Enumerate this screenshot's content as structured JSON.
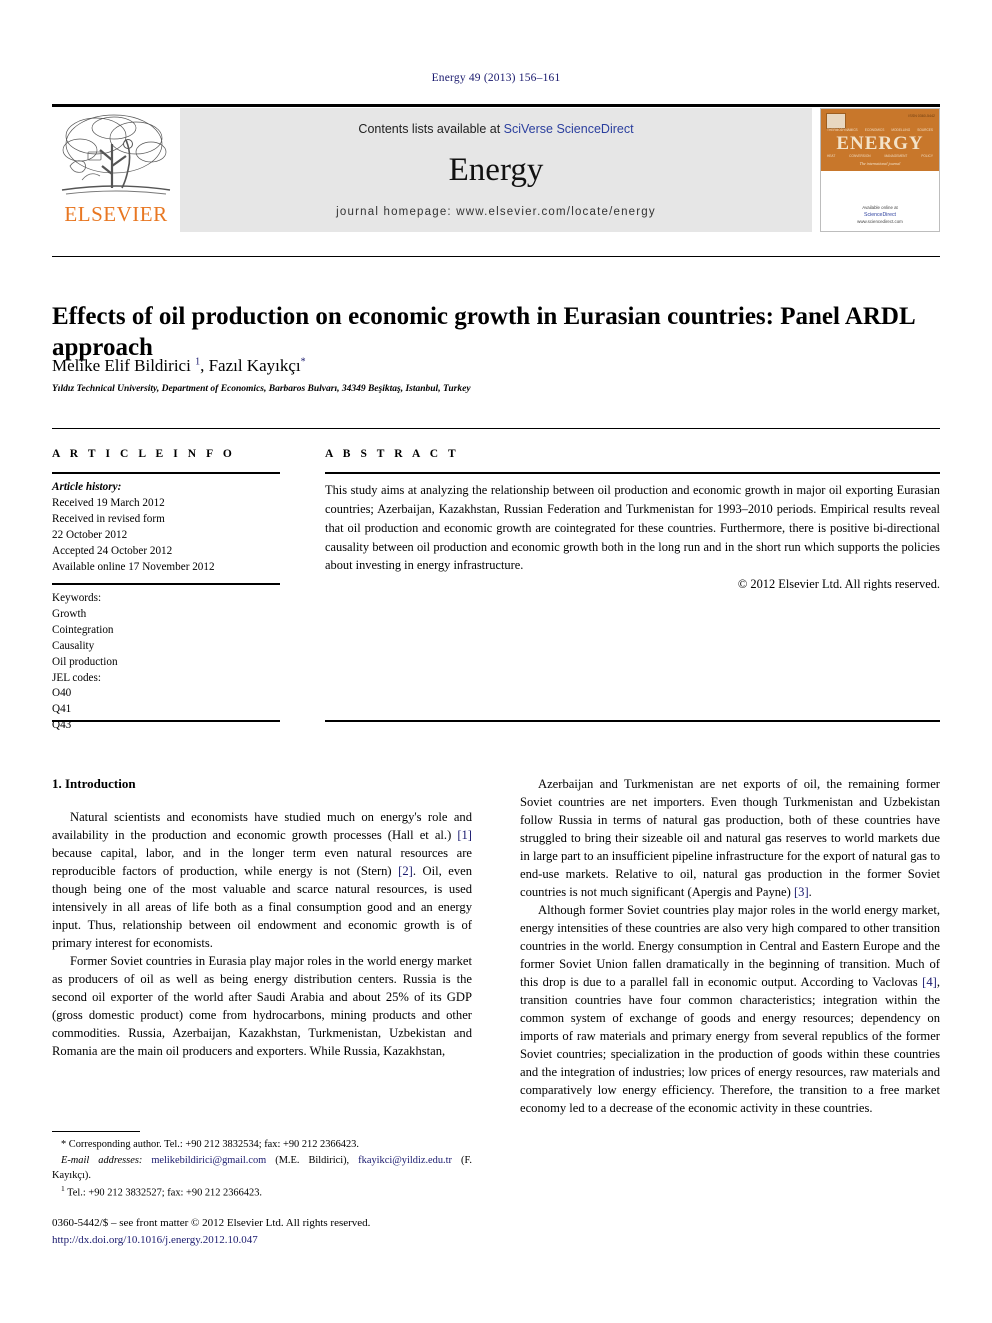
{
  "running_head": "Energy 49 (2013) 156–161",
  "masthead": {
    "contents_prefix": "Contents lists available at ",
    "sciencedirect": "SciVerse ScienceDirect",
    "journal_name": "Energy",
    "homepage": "journal homepage: www.elsevier.com/locate/energy",
    "publisher_wordmark": "ELSEVIER",
    "cover": {
      "title": "ENERGY",
      "subtitle": "The international journal",
      "code": "ISSN 0360-5442",
      "tags_top": [
        "THERMODYNAMICS",
        "ECONOMICS",
        "MODELLING",
        "SOURCES"
      ],
      "tags_bottom": [
        "HEAT",
        "CONVERSION",
        "MANAGEMENT",
        "POLICY"
      ],
      "available_at": "Available online at",
      "brand": "ScienceDirect",
      "site": "www.sciencedirect.com"
    }
  },
  "article": {
    "title": "Effects of oil production on economic growth in Eurasian countries: Panel ARDL approach",
    "authors_html": "Melike Elif Bildirici <sup>1</sup>, Fazıl Kayıkçı<sup>*</sup>",
    "affiliation": "Yıldız Technical University, Department of Economics, Barbaros Bulvarı, 34349 Beşiktaş, Istanbul, Turkey"
  },
  "info": {
    "heading": "A R T I C L E   I N F O",
    "history_label": "Article history:",
    "history": [
      "Received 19 March 2012",
      "Received in revised form",
      "22 October 2012",
      "Accepted 24 October 2012",
      "Available online 17 November 2012"
    ],
    "keywords_label": "Keywords:",
    "keywords": [
      "Growth",
      "Cointegration",
      "Causality",
      "Oil production"
    ],
    "jel_label": "JEL codes:",
    "jel_codes": [
      "O40",
      "Q41",
      "Q43"
    ]
  },
  "abstract": {
    "heading": "A B S T R A C T",
    "text": "This study aims at analyzing the relationship between oil production and economic growth in major oil exporting Eurasian countries; Azerbaijan, Kazakhstan, Russian Federation and Turkmenistan for 1993–2010 periods. Empirical results reveal that oil production and economic growth are cointegrated for these countries. Furthermore, there is positive bi-directional causality between oil production and economic growth both in the long run and in the short run which supports the policies about investing in energy infrastructure.",
    "copyright": "© 2012 Elsevier Ltd. All rights reserved."
  },
  "body": {
    "section_heading": "1. Introduction",
    "left_paragraphs": [
      {
        "pre": "Natural scientists and economists have studied much on energy's role and availability in the production and economic growth processes (Hall et al.) ",
        "ref1": "[1]",
        "mid": " because capital, labor, and in the longer term even natural resources are reproducible factors of production, while energy is not (Stern) ",
        "ref2": "[2]",
        "post": ". Oil, even though being one of the most valuable and scarce natural resources, is used intensively in all areas of life both as a final consumption good and an energy input. Thus, relationship between oil endowment and economic growth is of primary interest for economists."
      },
      {
        "text": "Former Soviet countries in Eurasia play major roles in the world energy market as producers of oil as well as being energy distribution centers. Russia is the second oil exporter of the world after Saudi Arabia and about 25% of its GDP (gross domestic product) come from hydrocarbons, mining products and other commodities. Russia, Azerbaijan, Kazakhstan, Turkmenistan, Uzbekistan and Romania are the main oil producers and exporters. While Russia, Kazakhstan,"
      }
    ],
    "right_paragraphs": [
      {
        "pre": "Azerbaijan and Turkmenistan are net exports of oil, the remaining former Soviet countries are net importers. Even though Turkmenistan and Uzbekistan follow Russia in terms of natural gas production, both of these countries have struggled to bring their sizeable oil and natural gas reserves to world markets due in large part to an insufficient pipeline infrastructure for the export of natural gas to end-use markets. Relative to oil, natural gas production in the former Soviet countries is not much significant (Apergis and Payne) ",
        "ref1": "[3]",
        "post": "."
      },
      {
        "pre": "Although former Soviet countries play major roles in the world energy market, energy intensities of these countries are also very high compared to other transition countries in the world. Energy consumption in Central and Eastern Europe and the former Soviet Union fallen dramatically in the beginning of transition. Much of this drop is due to a parallel fall in economic output. According to Vaclovas ",
        "ref1": "[4]",
        "post": ", transition countries have four common characteristics; integration within the common system of exchange of goods and energy resources; dependency on imports of raw materials and primary energy from several republics of the former Soviet countries; specialization in the production of goods within these countries and the integration of industries; low prices of energy resources, raw materials and comparatively low energy efficiency. Therefore, the transition to a free market economy led to a decrease of the economic activity in these countries."
      }
    ]
  },
  "footnotes": {
    "corresponding": "* Corresponding author. Tel.: +90 212 3832534; fax: +90 212 2366423.",
    "email_label": "E-mail addresses:",
    "email1": "melikebildirici@gmail.com",
    "email1_owner": "(M.E. Bildirici),",
    "email2": "fkayikci@yildiz.edu.tr",
    "email2_owner": "(F. Kayıkçı).",
    "footnote1_marker": "1",
    "footnote1": "Tel.: +90 212 3832527; fax: +90 212 2366423."
  },
  "imprint": {
    "issn_line": "0360-5442/$ – see front matter © 2012 Elsevier Ltd. All rights reserved.",
    "doi": "http://dx.doi.org/10.1016/j.energy.2012.10.047"
  }
}
